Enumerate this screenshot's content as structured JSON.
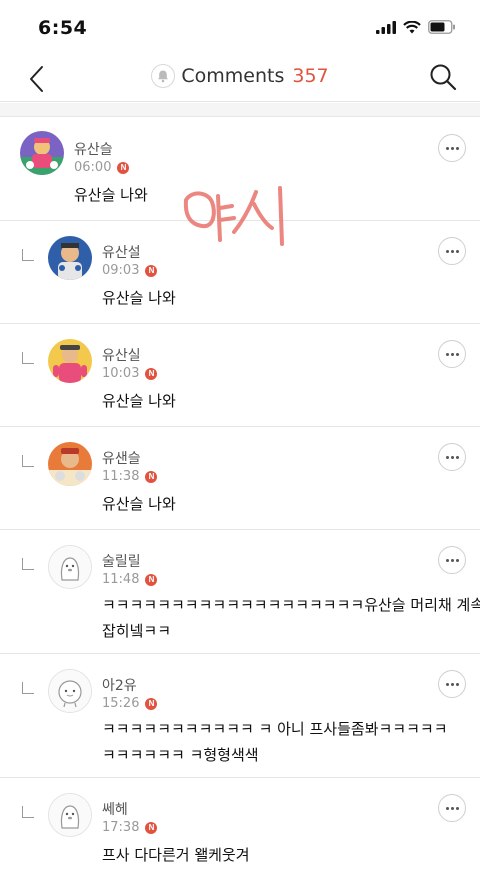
{
  "status_bar": {
    "time": "6:54"
  },
  "nav": {
    "title": "Comments",
    "count": "357"
  },
  "comments": [
    {
      "nickname": "유산슬",
      "time": "06:00",
      "badge": "N",
      "text": "유산슬 나와",
      "reply": false
    },
    {
      "nickname": "유산설",
      "time": "09:03",
      "badge": "N",
      "text": "유산슬 나와",
      "reply": true
    },
    {
      "nickname": "유산실",
      "time": "10:03",
      "badge": "N",
      "text": "유산슬 나와",
      "reply": true
    },
    {
      "nickname": "유샌슬",
      "time": "11:38",
      "badge": "N",
      "text": "유산슬 나와",
      "reply": true
    },
    {
      "nickname": "술릴릴",
      "time": "11:48",
      "badge": "N",
      "text_lines": [
        "ㅋㅋㅋㅋㅋㅋㅋㅋㅋㅋㅋㅋㅋㅋㅋㅋㅋㅋㅋ유산슬 머리채 계속 붙",
        "잡히넼ㅋㅋ"
      ],
      "reply": true
    },
    {
      "nickname": "아2유",
      "time": "15:26",
      "badge": "N",
      "text_lines": [
        "ㅋㅋㅋㅋㅋㅋㅋㅋㅋㅋㅋ ㅋ 아니 프사들좀봐ㅋㅋㅋㅋㅋ",
        "ㅋㅋㅋㅋㅋㅋ ㅋ형형색색"
      ],
      "reply": true
    },
    {
      "nickname": "쎄헤",
      "time": "17:38",
      "badge": "N",
      "text": "프사 다다른거 왤케웃겨",
      "reply": true
    }
  ],
  "overlay": {
    "handwritten_text": "여시"
  },
  "colors": {
    "accent": "#e2533f",
    "divider": "#e6e6e6"
  },
  "icons": [
    "back-arrow-icon",
    "bell-icon",
    "search-icon",
    "more-icon",
    "reply-icon",
    "new-badge-icon"
  ]
}
